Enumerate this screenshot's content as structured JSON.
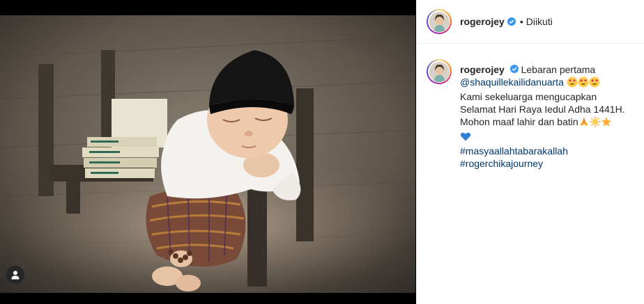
{
  "post": {
    "username": "rogerojey",
    "follow_status": "Diikuti",
    "separator": "•"
  },
  "caption": {
    "username": "rogerojey",
    "first_text": "Lebaran pertama",
    "mention": "@shaquillekailidanuarta",
    "line2": "Kami sekeluarga mengucapkan",
    "line3": "Selamat Hari Raya Iedul Adha 1441H.",
    "line4": "Mohon maaf lahir dan batin",
    "hashtags": [
      "#masyaallahtabarakallah",
      "#rogerchikajourney"
    ]
  },
  "icons": {
    "verified": "verified-badge-icon",
    "tag": "user-tag-icon",
    "emojis_line1": [
      "heart-eyes-emoji",
      "heart-eyes-emoji",
      "heart-eyes-emoji"
    ],
    "emojis_line4": [
      "folded-hands-emoji",
      "sun-emoji",
      "star-emoji"
    ],
    "emojis_line5": [
      "blue-heart-emoji"
    ]
  },
  "colors": {
    "verified": "#3897f0",
    "link": "#00376b",
    "text": "#262626"
  }
}
